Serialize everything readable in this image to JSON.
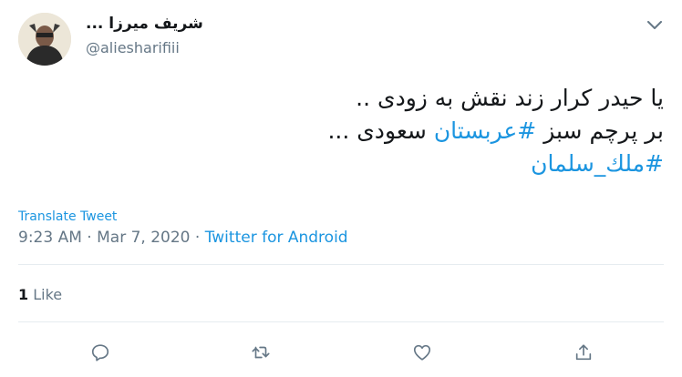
{
  "author": {
    "display_name": "شریف میرزا ...",
    "handle": "@aliesharifiii"
  },
  "tweet": {
    "line1": "یا حیدر کرار زند نقش به زودی ..",
    "line2_prefix": "بر پرچم سبز ",
    "line2_hashtag": "#عربستان",
    "line2_suffix": " سعودی ...",
    "line3_hashtag": "#ملك_سلمان"
  },
  "translate_label": "Translate Tweet",
  "meta": {
    "time": "9:23 AM",
    "sep1": " · ",
    "date": "Mar 7, 2020",
    "sep2": " · ",
    "source": "Twitter for Android"
  },
  "likes": {
    "count": "1",
    "label": "Like"
  },
  "icons": {
    "menu": "chevron-down-icon",
    "reply": "reply-icon",
    "retweet": "retweet-icon",
    "like": "heart-icon",
    "share": "share-icon"
  },
  "colors": {
    "link": "#1b95e0",
    "secondary_text": "#657786",
    "primary_text": "#14171a",
    "divider": "#e6ecf0"
  }
}
